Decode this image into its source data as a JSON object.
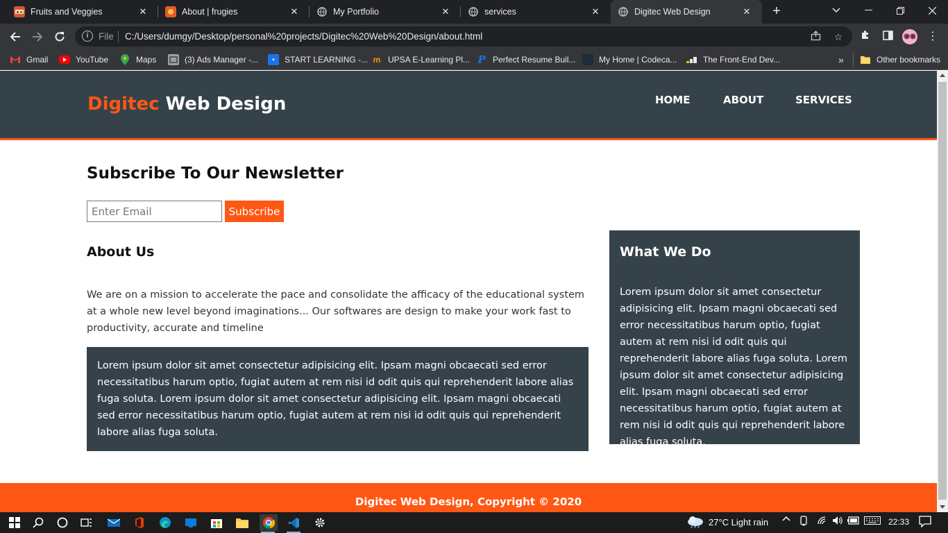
{
  "browser": {
    "tabs": [
      {
        "title": "Fruits and Veggies",
        "icon": "fruit-favicon",
        "active": false
      },
      {
        "title": "About | frugies",
        "icon": "frugies-favicon",
        "active": false
      },
      {
        "title": "My Portfolio",
        "icon": "globe-icon",
        "active": false
      },
      {
        "title": "services",
        "icon": "globe-icon",
        "active": false
      },
      {
        "title": "Digitec Web Design",
        "icon": "globe-icon",
        "active": true
      }
    ],
    "close_glyph": "✕",
    "new_tab_glyph": "+",
    "address": {
      "scheme_label": "File",
      "url": "C:/Users/dumgy/Desktop/personal%20projects/Digitec%20Web%20Design/about.html"
    },
    "bookmarks": [
      {
        "label": "Gmail",
        "icon": "gmail-icon"
      },
      {
        "label": "YouTube",
        "icon": "youtube-icon"
      },
      {
        "label": "Maps",
        "icon": "maps-icon"
      },
      {
        "label": "(3) Ads Manager -...",
        "icon": "ads-manager-icon"
      },
      {
        "label": "START LEARNING -...",
        "icon": "start-learning-icon"
      },
      {
        "label": "UPSA E-Learning Pl...",
        "icon": "upsa-icon"
      },
      {
        "label": "Perfect Resume Buil...",
        "icon": "resume-icon"
      },
      {
        "label": "My Home | Codeca...",
        "icon": "codecademy-icon"
      },
      {
        "label": "The Front-End Dev...",
        "icon": "frontend-icon"
      }
    ],
    "overflow_glyph": "»",
    "other_bookmarks": "Other bookmarks"
  },
  "site": {
    "brand_highlight": "Digitec",
    "brand_rest": " Web Design",
    "nav": [
      "HOME",
      "ABOUT",
      "SERVICES"
    ],
    "newsletter": {
      "title": "Subscribe To Our Newsletter",
      "placeholder": "Enter Email",
      "button": "Subscribe"
    },
    "about": {
      "title": "About Us",
      "text": "We are on a mission to accelerate the pace and consolidate the afficacy of the educational system at a whole new level beyond imaginations... Our softwares are design to make your work fast to productivity, accurate and timeline",
      "box_text": "Lorem ipsum dolor sit amet consectetur adipisicing elit. Ipsam magni obcaecati sed error necessitatibus harum optio, fugiat autem at rem nisi id odit quis qui reprehenderit labore alias fuga soluta. Lorem ipsum dolor sit amet consectetur adipisicing elit. Ipsam magni obcaecati sed error necessitatibus harum optio, fugiat autem at rem nisi id odit quis qui reprehenderit labore alias fuga soluta."
    },
    "sidebar": {
      "title": "What We Do",
      "text": "Lorem ipsum dolor sit amet consectetur adipisicing elit. Ipsam magni obcaecati sed error necessitatibus harum optio, fugiat autem at rem nisi id odit quis qui reprehenderit labore alias fuga soluta. Lorem ipsum dolor sit amet consectetur adipisicing elit. Ipsam magni obcaecati sed error necessitatibus harum optio, fugiat autem at rem nisi id odit quis qui reprehenderit labore alias fuga soluta."
    },
    "footer": "Digitec Web Design, Copyright © 2020"
  },
  "taskbar": {
    "weather": "27°C  Light rain",
    "time": "22:33"
  },
  "colors": {
    "accent": "#ff5714",
    "dark": "#35424a",
    "chrome_bg": "#202124",
    "chrome_toolbar": "#35363a"
  }
}
